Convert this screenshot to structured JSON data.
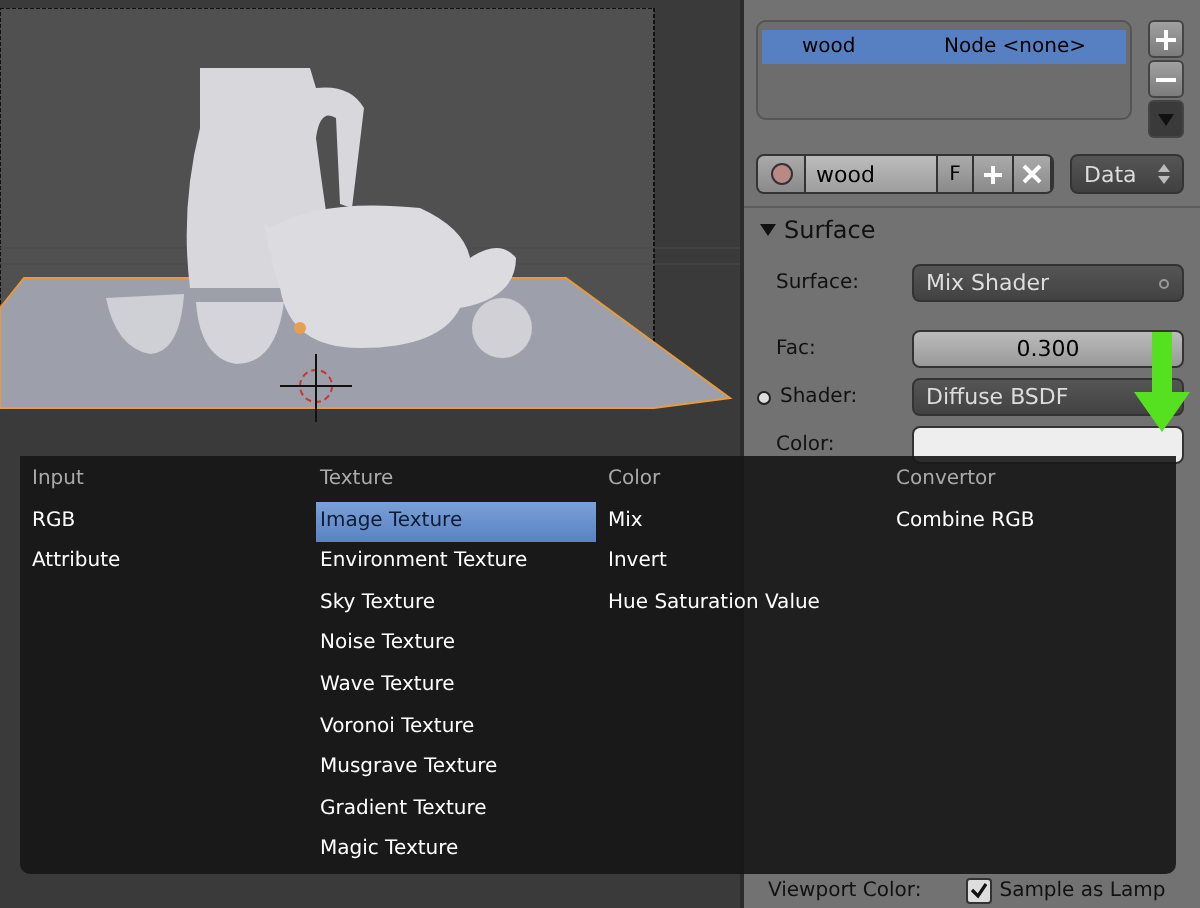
{
  "material_list": {
    "rows": [
      {
        "name": "wood",
        "node": "Node <none>",
        "selected": true
      }
    ]
  },
  "material_bar": {
    "name": "wood",
    "fake_user": "F",
    "link": "Data"
  },
  "surface_panel": {
    "title": "Surface",
    "expanded": true,
    "fields": [
      {
        "label": "Surface:",
        "kind": "dropdown",
        "value": "Mix Shader",
        "socket": false
      },
      {
        "label": "Fac:",
        "kind": "number",
        "value": "0.300",
        "socket": false
      },
      {
        "label": "Shader:",
        "kind": "dropdown",
        "value": "Diffuse BSDF",
        "socket": true
      },
      {
        "label": "Color:",
        "kind": "color",
        "socket": false
      }
    ]
  },
  "add_menu": {
    "columns": [
      {
        "heading": "Input",
        "items": [
          {
            "label": "RGB",
            "selected": false
          },
          {
            "label": "Attribute",
            "selected": false
          }
        ]
      },
      {
        "heading": "Texture",
        "items": [
          {
            "label": "Image Texture",
            "selected": true
          },
          {
            "label": "Environment Texture",
            "selected": false
          },
          {
            "label": "Sky Texture",
            "selected": false
          },
          {
            "label": "Noise Texture",
            "selected": false
          },
          {
            "label": "Wave Texture",
            "selected": false
          },
          {
            "label": "Voronoi Texture",
            "selected": false
          },
          {
            "label": "Musgrave Texture",
            "selected": false
          },
          {
            "label": "Gradient Texture",
            "selected": false
          },
          {
            "label": "Magic Texture",
            "selected": false
          }
        ]
      },
      {
        "heading": "Color",
        "items": [
          {
            "label": "Mix",
            "selected": false
          },
          {
            "label": "Invert",
            "selected": false
          },
          {
            "label": "Hue Saturation Value",
            "selected": false
          }
        ]
      },
      {
        "heading": "Convertor",
        "items": [
          {
            "label": "Combine RGB",
            "selected": false
          }
        ]
      }
    ]
  },
  "viewport_settings": {
    "label": "Viewport Color:",
    "checkbox": {
      "label": "Sample as Lamp",
      "checked": true
    }
  }
}
